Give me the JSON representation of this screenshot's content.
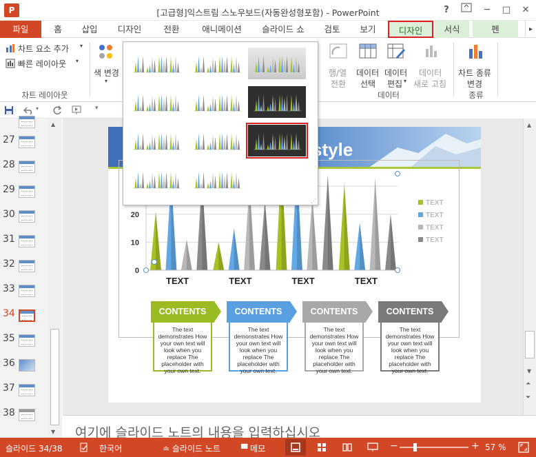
{
  "titlebar": {
    "app_logo": "P",
    "title": "[고급형]익스트림 스노우보드(자동완성형포함) - PowerPoint",
    "help": "?",
    "minimize": "─",
    "restore": "□",
    "close": "✕"
  },
  "tabs": [
    {
      "label": "파일"
    },
    {
      "label": "홈"
    },
    {
      "label": "삽입"
    },
    {
      "label": "디자인"
    },
    {
      "label": "전환"
    },
    {
      "label": "애니메이션"
    },
    {
      "label": "슬라이드 쇼"
    },
    {
      "label": "검토"
    },
    {
      "label": "보기"
    },
    {
      "label": "디자인"
    },
    {
      "label": "서식"
    },
    {
      "label": "펜"
    }
  ],
  "ribbon": {
    "add_chart_element": "차트 요소 추가",
    "quick_layout": "빠른 레이아웃",
    "change_colors": "색 변경",
    "group_chart_layouts": "차트 레이아웃",
    "switch_row_col_1": "행/열",
    "switch_row_col_2": "전환",
    "select_data_1": "데이터",
    "select_data_2": "선택",
    "edit_data_1": "데이터",
    "edit_data_2": "편집",
    "refresh_data_1": "데이터",
    "refresh_data_2": "새로 고침",
    "group_data": "데이터",
    "change_chart_type_1": "차트 종류",
    "change_chart_type_2": "변경",
    "group_type": "종류"
  },
  "thumbnails": [
    {
      "num": "27"
    },
    {
      "num": "28"
    },
    {
      "num": "29"
    },
    {
      "num": "30"
    },
    {
      "num": "31"
    },
    {
      "num": "32"
    },
    {
      "num": "33"
    },
    {
      "num": "34"
    },
    {
      "num": "35"
    },
    {
      "num": "36"
    },
    {
      "num": "37"
    },
    {
      "num": "38"
    }
  ],
  "current_slide": "34",
  "slide": {
    "title_fragment": "style",
    "contents": [
      {
        "head": "CONTENTS",
        "body": "The text demonstrates How your own text will look when you replace The placeholder with your own text.",
        "color": "#9bbb22"
      },
      {
        "head": "CONTENTS",
        "body": "The text demonstrates How your own text will look when you replace The placeholder with your own text.",
        "color": "#5aa0e0"
      },
      {
        "head": "CONTENTS",
        "body": "The text demonstrates How your own text will look when you replace The placeholder with your own text.",
        "color": "#a8a8a8"
      },
      {
        "head": "CONTENTS",
        "body": "The text demonstrates How your own text will look when you replace The placeholder with your own text.",
        "color": "#7a7a7a"
      }
    ]
  },
  "chart_data": {
    "type": "bar",
    "categories": [
      "TEXT",
      "TEXT",
      "TEXT",
      "TEXT"
    ],
    "series": [
      {
        "name": "TEXT",
        "values": [
          21,
          10,
          45,
          31
        ],
        "color": "#a8c022"
      },
      {
        "name": "TEXT",
        "values": [
          33,
          15,
          38,
          17
        ],
        "color": "#62a8e6"
      },
      {
        "name": "TEXT",
        "values": [
          11,
          31,
          26,
          33
        ],
        "color": "#b8b8b8"
      },
      {
        "name": "TEXT",
        "values": [
          33,
          25,
          34,
          20
        ],
        "color": "#8a8a8a"
      }
    ],
    "y_ticks": [
      "0",
      "10",
      "20",
      "30"
    ],
    "ylim": [
      0,
      30
    ],
    "grid": true,
    "legend": "right"
  },
  "notes_placeholder": "여기에 슬라이드 노트의 내용을 입력하십시오",
  "statusbar": {
    "slide_info": "슬라이드 34/38",
    "language": "한국어",
    "notes_btn": "슬라이드 노트",
    "comments_btn": "메모",
    "zoom_minus": "−",
    "zoom_plus": "+",
    "zoom": "57 %"
  },
  "colors": {
    "accent": "#d24726",
    "context_tab": "#dcefd8",
    "highlight": "#e02020"
  }
}
